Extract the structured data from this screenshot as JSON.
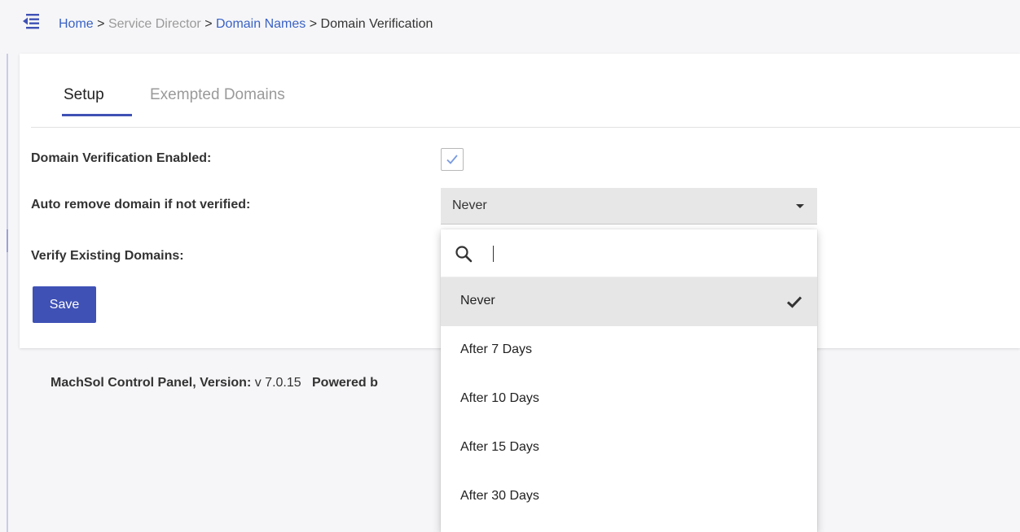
{
  "breadcrumb": {
    "home": "Home",
    "sep1": ">",
    "service_director": "Service Director",
    "sep2": ">",
    "domain_names": "Domain Names",
    "sep3": ">",
    "current": "Domain Verification"
  },
  "tabs": [
    {
      "label": "Setup",
      "active": true
    },
    {
      "label": "Exempted Domains",
      "active": false
    }
  ],
  "form": {
    "verification_enabled_label": "Domain Verification Enabled:",
    "verification_enabled_checked": true,
    "auto_remove_label": "Auto remove domain if not verified:",
    "auto_remove_value": "Never",
    "verify_existing_label": "Verify Existing Domains:",
    "save_label": "Save"
  },
  "footer": {
    "product_label": "MachSol Control Panel, Version:",
    "version": "v 7.0.15",
    "powered_label": "Powered b"
  },
  "dropdown": {
    "search_value": "",
    "options": [
      {
        "label": "Never",
        "selected": true
      },
      {
        "label": "After 7 Days",
        "selected": false
      },
      {
        "label": "After 10 Days",
        "selected": false
      },
      {
        "label": "After 15 Days",
        "selected": false
      },
      {
        "label": "After 30 Days",
        "selected": false
      }
    ]
  },
  "icons": {
    "menu": "menu-collapse-icon",
    "check": "checkmark-icon",
    "search": "search-icon"
  },
  "colors": {
    "accent": "#3f51b5",
    "link": "#3a62c4",
    "checkbox_tick": "#7a9be0"
  }
}
